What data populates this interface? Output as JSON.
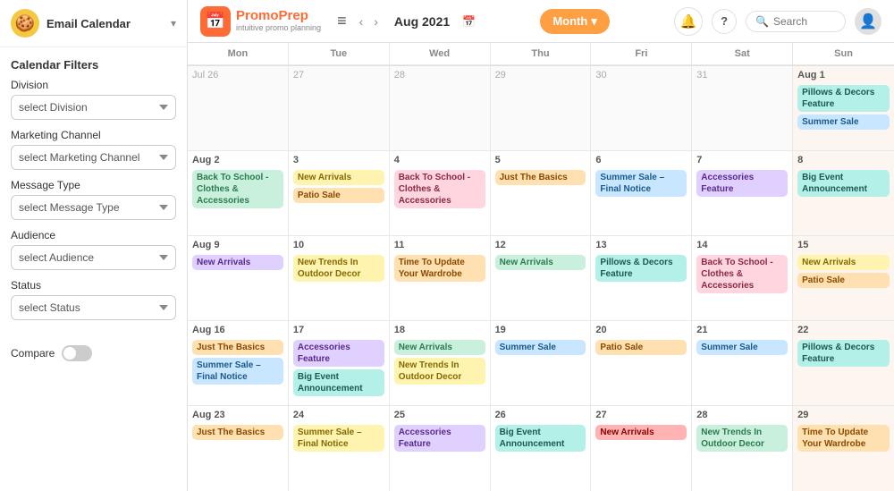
{
  "topbar": {
    "logo_name": "PromoPrep",
    "logo_sub": "intuitive promo planning",
    "menu_icon": "≡",
    "prev_icon": "‹",
    "next_icon": "›",
    "date": "Aug 2021",
    "month_btn": "Month",
    "help": "?",
    "search_placeholder": "Search",
    "bell": "🔔"
  },
  "sidebar": {
    "avatar_icon": "🍪",
    "calendar_title": "Email Calendar",
    "filters_title": "Calendar Filters",
    "division_label": "Division",
    "division_placeholder": "select Division",
    "marketing_label": "Marketing Channel",
    "marketing_placeholder": "select Marketing Channel",
    "message_label": "Message Type",
    "message_placeholder": "select Message Type",
    "audience_label": "Audience",
    "audience_placeholder": "select Audience",
    "status_label": "Status",
    "status_placeholder": "select Status",
    "compare_label": "Compare"
  },
  "calendar": {
    "headers": [
      "Mon",
      "Tue",
      "Wed",
      "Thu",
      "Fri",
      "Sat",
      "Sun"
    ],
    "weeks": [
      [
        {
          "num": "Jul 26",
          "other": true,
          "events": []
        },
        {
          "num": "27",
          "other": true,
          "events": []
        },
        {
          "num": "28",
          "other": true,
          "events": []
        },
        {
          "num": "29",
          "other": true,
          "events": []
        },
        {
          "num": "30",
          "other": true,
          "events": []
        },
        {
          "num": "31",
          "other": true,
          "events": []
        },
        {
          "num": "Aug 1",
          "sun": true,
          "events": [
            {
              "label": "Pillows & Decors Feature",
              "cls": "ev-teal"
            },
            {
              "label": "Summer Sale",
              "cls": "ev-blue"
            }
          ]
        }
      ],
      [
        {
          "num": "Aug 2",
          "events": [
            {
              "label": "Back To School - Clothes & Accessories",
              "cls": "ev-green"
            }
          ]
        },
        {
          "num": "3",
          "events": [
            {
              "label": "New Arrivals",
              "cls": "ev-yellow"
            },
            {
              "label": "Patio Sale",
              "cls": "ev-orange"
            }
          ]
        },
        {
          "num": "4",
          "events": [
            {
              "label": "Back To School - Clothes & Accessories",
              "cls": "ev-pink"
            }
          ]
        },
        {
          "num": "5",
          "events": [
            {
              "label": "Just The Basics",
              "cls": "ev-orange"
            }
          ]
        },
        {
          "num": "6",
          "events": [
            {
              "label": "Summer Sale – Final Notice",
              "cls": "ev-blue"
            }
          ]
        },
        {
          "num": "7",
          "events": [
            {
              "label": "Accessories Feature",
              "cls": "ev-purple"
            }
          ]
        },
        {
          "num": "8",
          "sun": true,
          "events": [
            {
              "label": "Big Event Announcement",
              "cls": "ev-teal"
            }
          ]
        }
      ],
      [
        {
          "num": "Aug 9",
          "events": [
            {
              "label": "New Arrivals",
              "cls": "ev-purple"
            }
          ]
        },
        {
          "num": "10",
          "events": [
            {
              "label": "New Trends In Outdoor Decor",
              "cls": "ev-yellow"
            }
          ]
        },
        {
          "num": "11",
          "events": [
            {
              "label": "Time To Update Your Wardrobe",
              "cls": "ev-orange"
            }
          ]
        },
        {
          "num": "12",
          "events": [
            {
              "label": "New Arrivals",
              "cls": "ev-green"
            }
          ]
        },
        {
          "num": "13",
          "events": [
            {
              "label": "Pillows & Decors Feature",
              "cls": "ev-teal"
            }
          ]
        },
        {
          "num": "14",
          "events": [
            {
              "label": "Back To School - Clothes & Accessories",
              "cls": "ev-pink"
            }
          ]
        },
        {
          "num": "15",
          "sun": true,
          "events": [
            {
              "label": "New Arrivals",
              "cls": "ev-yellow"
            },
            {
              "label": "Patio Sale",
              "cls": "ev-orange"
            }
          ]
        }
      ],
      [
        {
          "num": "Aug 16",
          "events": [
            {
              "label": "Just The Basics",
              "cls": "ev-orange"
            },
            {
              "label": "Summer Sale – Final Notice",
              "cls": "ev-blue"
            }
          ]
        },
        {
          "num": "17",
          "events": [
            {
              "label": "Accessories Feature",
              "cls": "ev-purple"
            },
            {
              "label": "Big Event Announcement",
              "cls": "ev-teal"
            }
          ]
        },
        {
          "num": "18",
          "events": [
            {
              "label": "New Arrivals",
              "cls": "ev-green"
            },
            {
              "label": "New Trends In Outdoor Decor",
              "cls": "ev-yellow"
            }
          ]
        },
        {
          "num": "19",
          "events": [
            {
              "label": "Summer Sale",
              "cls": "ev-blue"
            }
          ]
        },
        {
          "num": "20",
          "events": [
            {
              "label": "Patio Sale",
              "cls": "ev-orange"
            }
          ]
        },
        {
          "num": "21",
          "events": [
            {
              "label": "Summer Sale",
              "cls": "ev-blue"
            }
          ]
        },
        {
          "num": "22",
          "sun": true,
          "events": [
            {
              "label": "Pillows & Decors Feature",
              "cls": "ev-teal"
            }
          ]
        }
      ],
      [
        {
          "num": "Aug 23",
          "events": [
            {
              "label": "Just The Basics",
              "cls": "ev-orange"
            }
          ]
        },
        {
          "num": "24",
          "events": [
            {
              "label": "Summer Sale – Final Notice",
              "cls": "ev-yellow"
            }
          ]
        },
        {
          "num": "25",
          "events": [
            {
              "label": "Accessories Feature",
              "cls": "ev-purple"
            }
          ]
        },
        {
          "num": "26",
          "events": [
            {
              "label": "Big Event Announcement",
              "cls": "ev-teal"
            }
          ]
        },
        {
          "num": "27",
          "events": [
            {
              "label": "New Arrivals",
              "cls": "ev-red"
            }
          ]
        },
        {
          "num": "28",
          "events": [
            {
              "label": "New Trends In Outdoor Decor",
              "cls": "ev-green"
            }
          ]
        },
        {
          "num": "29",
          "sun": true,
          "events": [
            {
              "label": "Time To Update Your Wardrobe",
              "cls": "ev-orange"
            }
          ]
        }
      ]
    ]
  }
}
